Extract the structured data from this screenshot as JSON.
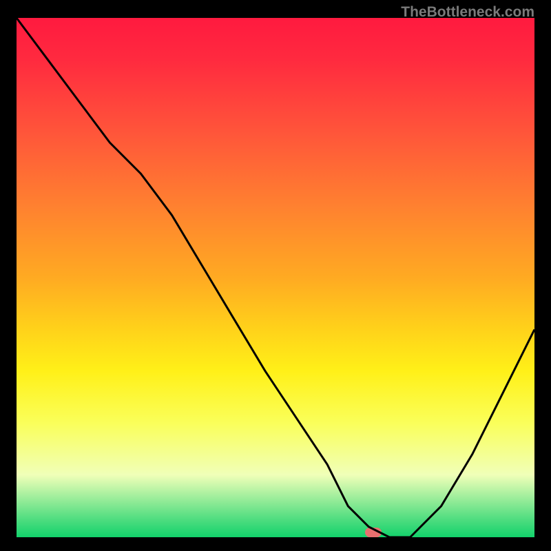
{
  "watermark": "TheBottleneck.com",
  "chart_data": {
    "type": "line",
    "title": "",
    "xlabel": "",
    "ylabel": "",
    "xlim": [
      0,
      100
    ],
    "ylim": [
      0,
      100
    ],
    "x": [
      0,
      6,
      12,
      18,
      24,
      30,
      36,
      42,
      48,
      54,
      60,
      64,
      68,
      72,
      76,
      82,
      88,
      94,
      100
    ],
    "values": [
      100,
      92,
      84,
      76,
      70,
      62,
      52,
      42,
      32,
      23,
      14,
      6,
      2,
      0,
      0,
      6,
      16,
      28,
      40
    ],
    "marker_x": 69,
    "gradient_stops": [
      {
        "pos": 0.0,
        "color": "#ff1a3f"
      },
      {
        "pos": 0.22,
        "color": "#ff553a"
      },
      {
        "pos": 0.5,
        "color": "#ffaa22"
      },
      {
        "pos": 0.68,
        "color": "#fff018"
      },
      {
        "pos": 0.88,
        "color": "#f0ffb8"
      },
      {
        "pos": 1.0,
        "color": "#12d26b"
      }
    ]
  }
}
